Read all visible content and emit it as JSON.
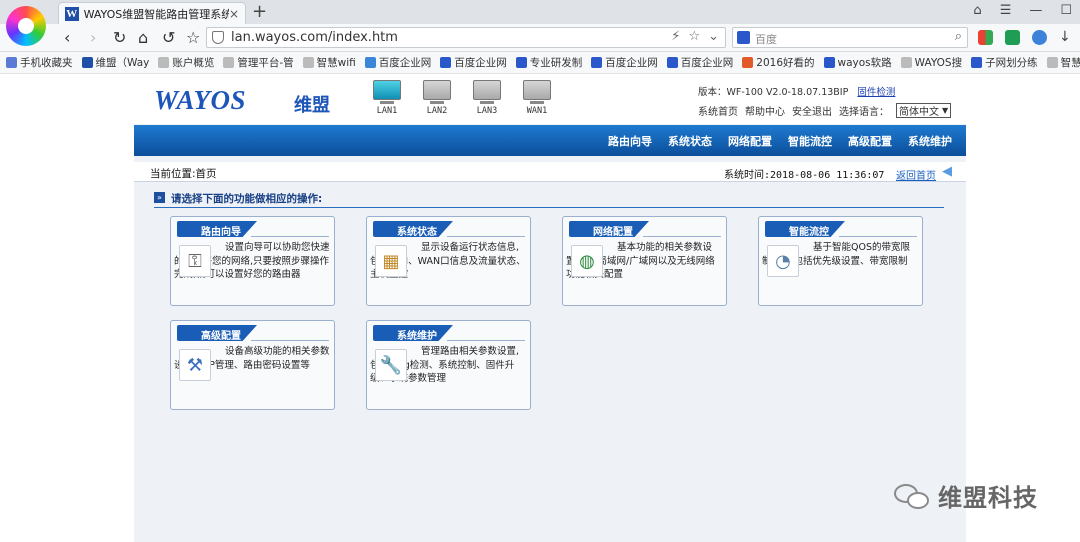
{
  "browser": {
    "tab_title": "WAYOS维盟智能路由管理系统",
    "tab_favicon": "W",
    "new_tab": "+",
    "url": "lan.wayos.com/index.htm",
    "search_placeholder": "百度",
    "bookmarks": [
      {
        "label": "手机收藏夹",
        "icon_color": "#5a7bd6"
      },
      {
        "label": "维盟（Way",
        "icon_color": "#1f4fa6"
      },
      {
        "label": "账户概览",
        "icon_color": "#bbbbbb"
      },
      {
        "label": "管理平台-管",
        "icon_color": "#bbbbbb"
      },
      {
        "label": "智慧wifi",
        "icon_color": "#bbbbbb"
      },
      {
        "label": "百度企业网",
        "icon_color": "#3a86d9"
      },
      {
        "label": "百度企业网",
        "icon_color": "#2a57c9"
      },
      {
        "label": "专业研发制",
        "icon_color": "#2a57c9"
      },
      {
        "label": "百度企业网",
        "icon_color": "#2a57c9"
      },
      {
        "label": "百度企业网",
        "icon_color": "#2a57c9"
      },
      {
        "label": "2016好看的",
        "icon_color": "#e25a2a"
      },
      {
        "label": "wayos软路",
        "icon_color": "#2a57c9"
      },
      {
        "label": "WAYOS搜",
        "icon_color": "#bbbbbb"
      },
      {
        "label": "子网划分练",
        "icon_color": "#2a57c9"
      },
      {
        "label": "智慧wifi",
        "icon_color": "#bbbbbb"
      }
    ]
  },
  "router": {
    "logo_text": "WAYOS",
    "logo_cn": "维盟",
    "ports": [
      {
        "label": "LAN1",
        "active": true
      },
      {
        "label": "LAN2",
        "active": false
      },
      {
        "label": "LAN3",
        "active": false
      },
      {
        "label": "WAN1",
        "active": false
      }
    ],
    "version": "版本：WF-100 V2.0-18.07.13BIP",
    "firmware_link": "固件检测",
    "header_links": {
      "home": "系统首页",
      "help": "帮助中心",
      "logout": "安全退出",
      "lang_label": "选择语言：",
      "lang_value": "简体中文"
    },
    "nav": [
      "路由向导",
      "系统状态",
      "网络配置",
      "智能流控",
      "高级配置",
      "系统维护"
    ],
    "location": "当前位置:首页",
    "system_time": "系统时间:2018-08-06 11:36:07",
    "home_link": "返回首页",
    "section_title": "请选择下面的功能做相应的操作:",
    "cards": [
      {
        "title": "路由向导",
        "icon": "key-icon",
        "desc": "设置向导可以协助您快速的配置好您的网络,只要按照步骤操作完成,就可以设置好您的路由器"
      },
      {
        "title": "系统状态",
        "icon": "chart-icon",
        "desc": "显示设备运行状态信息,包括LAN、WAN口信息及流量状态、主机监控"
      },
      {
        "title": "网络配置",
        "icon": "globe-icon",
        "desc": "基本功能的相关参数设置,包括局域网/广域网以及无线网络功能相关配置"
      },
      {
        "title": "智能流控",
        "icon": "speedometer-icon",
        "desc": "基于智能QOS的带宽限制功能,包括优先级设置、带宽限制"
      },
      {
        "title": "高级配置",
        "icon": "tools-icon",
        "desc": "设备高级功能的相关参数设置,ARP管理、路由密码设置等"
      },
      {
        "title": "系统维护",
        "icon": "wrench-icon",
        "desc": "管理路由相关参数设置,包括ping检测、系统控制、固件升级、系统参数管理"
      }
    ]
  },
  "watermark": {
    "text": "维盟科技"
  },
  "colors": {
    "nav_blue": "#0c4e9a",
    "brand_blue": "#1d56b8",
    "tab_blue": "#1a5db6"
  }
}
